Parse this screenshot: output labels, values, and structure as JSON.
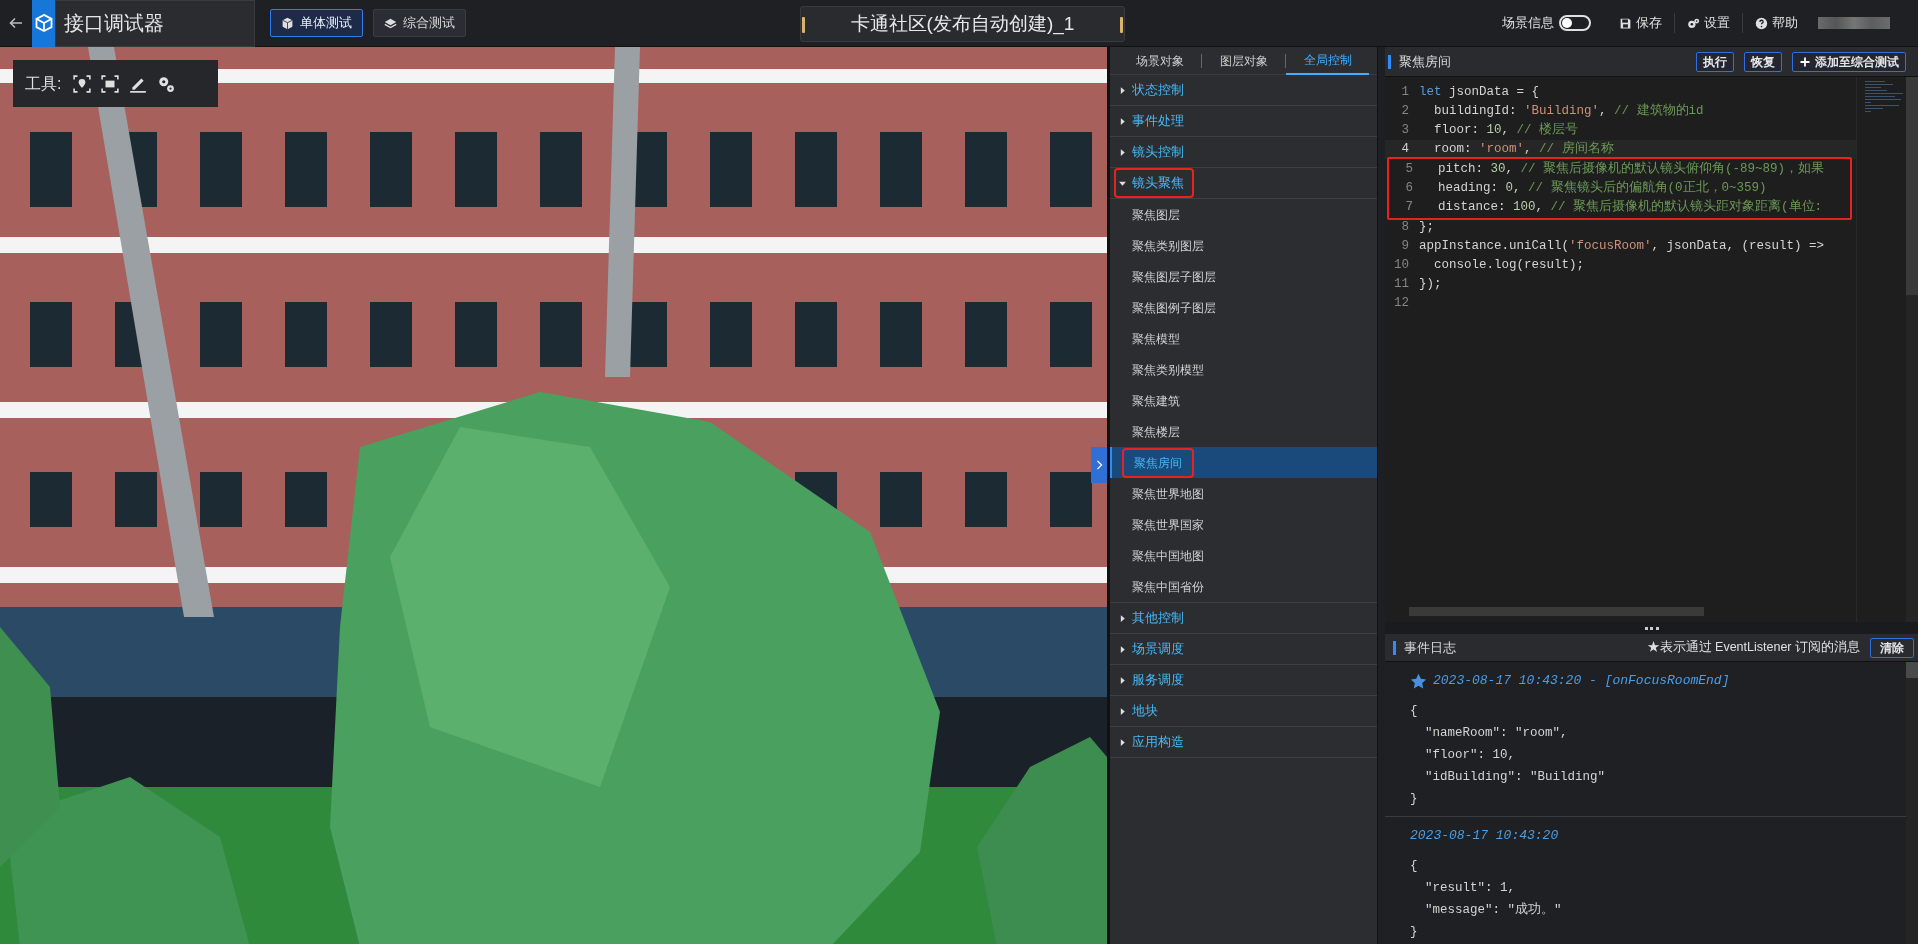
{
  "app": {
    "title": "接口调试器"
  },
  "mode_buttons": [
    {
      "label": "单体测试",
      "selected": true
    },
    {
      "label": "综合测试",
      "selected": false
    }
  ],
  "scene_title": "卡通社区(发布自动创建)_1",
  "header_actions": {
    "scene_info": {
      "label": "场景信息",
      "on": false
    },
    "items": [
      {
        "label": "保存"
      },
      {
        "label": "设置"
      },
      {
        "label": "帮助"
      }
    ]
  },
  "viewport": {
    "tools_label": "工具:"
  },
  "tree": {
    "tabs": [
      {
        "label": "场景对象",
        "selected": false
      },
      {
        "label": "图层对象",
        "selected": false
      },
      {
        "label": "全局控制",
        "selected": true
      }
    ],
    "groups": [
      {
        "label": "状态控制",
        "expanded": false,
        "annotated": false
      },
      {
        "label": "事件处理",
        "expanded": false,
        "annotated": false
      },
      {
        "label": "镜头控制",
        "expanded": false,
        "annotated": false
      },
      {
        "label": "镜头聚焦",
        "expanded": true,
        "annotated": true,
        "children": [
          {
            "label": "聚焦图层",
            "selected": false,
            "annotated": false
          },
          {
            "label": "聚焦类别图层",
            "selected": false,
            "annotated": false
          },
          {
            "label": "聚焦图层子图层",
            "selected": false,
            "annotated": false
          },
          {
            "label": "聚焦图例子图层",
            "selected": false,
            "annotated": false
          },
          {
            "label": "聚焦模型",
            "selected": false,
            "annotated": false
          },
          {
            "label": "聚焦类别模型",
            "selected": false,
            "annotated": false
          },
          {
            "label": "聚焦建筑",
            "selected": false,
            "annotated": false
          },
          {
            "label": "聚焦楼层",
            "selected": false,
            "annotated": false
          },
          {
            "label": "聚焦房间",
            "selected": true,
            "annotated": true
          },
          {
            "label": "聚焦世界地图",
            "selected": false,
            "annotated": false
          },
          {
            "label": "聚焦世界国家",
            "selected": false,
            "annotated": false
          },
          {
            "label": "聚焦中国地图",
            "selected": false,
            "annotated": false
          },
          {
            "label": "聚焦中国省份",
            "selected": false,
            "annotated": false
          }
        ]
      },
      {
        "label": "其他控制",
        "expanded": false,
        "annotated": false
      },
      {
        "label": "场景调度",
        "expanded": false,
        "annotated": false
      },
      {
        "label": "服务调度",
        "expanded": false,
        "annotated": false
      },
      {
        "label": "地块",
        "expanded": false,
        "annotated": false
      },
      {
        "label": "应用构造",
        "expanded": false,
        "annotated": false
      }
    ]
  },
  "editor": {
    "title": "聚焦房间",
    "buttons": [
      {
        "label": "执行",
        "kind": "plain"
      },
      {
        "label": "恢复",
        "kind": "plain"
      },
      {
        "label": "添加至综合测试",
        "kind": "add"
      }
    ],
    "lines": [
      {
        "number": "1",
        "current": false,
        "boxed": false,
        "tokens": [
          {
            "kind": "keyword",
            "t": "let"
          },
          {
            "kind": "plain",
            "t": " jsonData = {"
          }
        ]
      },
      {
        "number": "2",
        "current": false,
        "boxed": false,
        "tokens": [
          {
            "kind": "plain",
            "t": "  buildingId: "
          },
          {
            "kind": "string",
            "t": "'Building'"
          },
          {
            "kind": "plain",
            "t": ", "
          },
          {
            "kind": "comment",
            "t": "// 建筑物的id"
          }
        ]
      },
      {
        "number": "3",
        "current": false,
        "boxed": false,
        "tokens": [
          {
            "kind": "plain",
            "t": "  floor: "
          },
          {
            "kind": "number",
            "t": "10"
          },
          {
            "kind": "plain",
            "t": ", "
          },
          {
            "kind": "comment",
            "t": "// 楼层号"
          }
        ]
      },
      {
        "number": "4",
        "current": true,
        "boxed": false,
        "tokens": [
          {
            "kind": "plain",
            "t": "  room: "
          },
          {
            "kind": "string",
            "t": "'room'"
          },
          {
            "kind": "plain",
            "t": ", "
          },
          {
            "kind": "comment",
            "t": "// 房间名称"
          }
        ]
      },
      {
        "number": "5",
        "current": false,
        "boxed": true,
        "tokens": [
          {
            "kind": "plain",
            "t": "  pitch: "
          },
          {
            "kind": "number",
            "t": "30"
          },
          {
            "kind": "plain",
            "t": ", "
          },
          {
            "kind": "comment",
            "t": "// 聚焦后摄像机的默认镜头俯仰角(-89~89)，如果"
          }
        ]
      },
      {
        "number": "6",
        "current": false,
        "boxed": true,
        "tokens": [
          {
            "kind": "plain",
            "t": "  heading: "
          },
          {
            "kind": "number",
            "t": "0"
          },
          {
            "kind": "plain",
            "t": ", "
          },
          {
            "kind": "comment",
            "t": "// 聚焦镜头后的偏航角(0正北，0~359)"
          }
        ]
      },
      {
        "number": "7",
        "current": false,
        "boxed": true,
        "tokens": [
          {
            "kind": "plain",
            "t": "  distance: "
          },
          {
            "kind": "number",
            "t": "100"
          },
          {
            "kind": "plain",
            "t": ", "
          },
          {
            "kind": "comment",
            "t": "// 聚焦后摄像机的默认镜头距对象距离(单位:"
          }
        ]
      },
      {
        "number": "8",
        "current": false,
        "boxed": false,
        "tokens": [
          {
            "kind": "plain",
            "t": "};"
          }
        ]
      },
      {
        "number": "9",
        "current": false,
        "boxed": false,
        "tokens": [
          {
            "kind": "plain",
            "t": "appInstance.uniCall("
          },
          {
            "kind": "string",
            "t": "'focusRoom'"
          },
          {
            "kind": "plain",
            "t": ", jsonData, (result) =>"
          }
        ]
      },
      {
        "number": "10",
        "current": false,
        "boxed": false,
        "tokens": [
          {
            "kind": "plain",
            "t": "  console.log(result);"
          }
        ]
      },
      {
        "number": "11",
        "current": false,
        "boxed": false,
        "tokens": [
          {
            "kind": "plain",
            "t": "});"
          }
        ]
      },
      {
        "number": "12",
        "current": false,
        "boxed": false
      }
    ]
  },
  "event_log": {
    "title": "事件日志",
    "note": "★表示通过 EventListener 订阅的消息",
    "clear_button": "清除",
    "entries": [
      {
        "starred": true,
        "header": "2023-08-17 10:43:20 - [onFocusRoomEnd]",
        "body": [
          "{",
          "  \"nameRoom\": \"room\",",
          "  \"floor\": 10,",
          "  \"idBuilding\": \"Building\"",
          "}"
        ]
      },
      {
        "starred": false,
        "header": "2023-08-17 10:43:20",
        "body": [
          "{",
          "  \"result\": 1,",
          "  \"message\": \"成功。\"",
          "}"
        ]
      }
    ]
  }
}
